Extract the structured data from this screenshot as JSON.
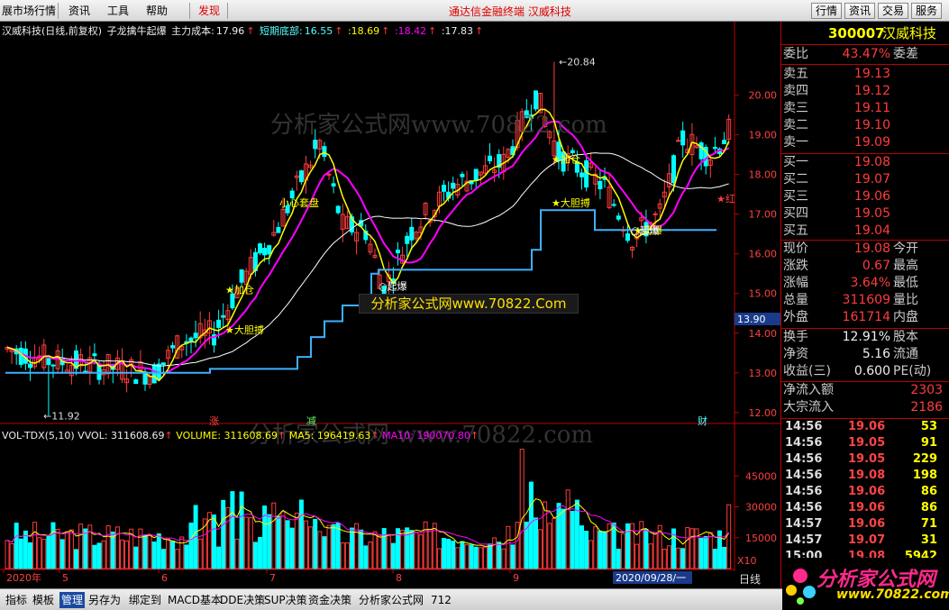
{
  "menu": {
    "items": [
      "展市场行情",
      "资讯",
      "工具",
      "帮助",
      "发现"
    ],
    "center_title": "通达信金融终端   汉威科技",
    "buttons": [
      "行情",
      "资讯",
      "交易",
      "服务"
    ]
  },
  "header": {
    "name": "汉威科技(日线,前复权)",
    "indicator": "子龙擒牛起爆",
    "cost_label": "主力成本:",
    "cost_value": "17.96",
    "bottom_label": "短期底部:",
    "bottom_value": "16.55",
    "v3": ":18.69",
    "v4": ":18.42",
    "v5": ":17.83"
  },
  "chart_data": {
    "type": "candlestick",
    "title": "汉威科技(日线,前复权)",
    "ylim": [
      11.7,
      21.4
    ],
    "y_ticks": [
      "20.00",
      "19.00",
      "18.00",
      "17.00",
      "16.00",
      "15.00",
      "14.00",
      "13.00",
      "12.00"
    ],
    "current_price_marker": "13.90",
    "high_label": "20.84",
    "low_label": "11.92",
    "annotations": [
      "小心套盘",
      "加仓",
      "大胆搏",
      "起爆",
      "起爆",
      "加仓",
      "大胆搏",
      "起爆",
      "红"
    ],
    "signals": [
      "涨",
      "减",
      "财"
    ],
    "volume": {
      "legend": [
        "VOL-TDX(5,10) VVOL: 311608.69",
        "VOLUME: 311608.69",
        "MA5: 196419.63",
        "MA10: 190070.80"
      ],
      "y_ticks": [
        "45000",
        "30000",
        "15000"
      ],
      "unit": "X10"
    },
    "date_axis": [
      "2020年",
      "5",
      "6",
      "7",
      "8",
      "9"
    ],
    "date_cursor": "2020/09/28/一"
  },
  "watermarks": {
    "top": "分析家公式网www.70822.com",
    "mid": "分析家公式网www.70822.Com",
    "vol": "分析家公式网 www.70822.com"
  },
  "quote": {
    "code": "300007",
    "name": "汉威科技",
    "weibi_label": "委比",
    "weibi": "43.47%",
    "weicha_label": "委差",
    "asks": [
      {
        "l": "卖五",
        "p": "19.13"
      },
      {
        "l": "卖四",
        "p": "19.12"
      },
      {
        "l": "卖三",
        "p": "19.11"
      },
      {
        "l": "卖二",
        "p": "19.10"
      },
      {
        "l": "卖一",
        "p": "19.09"
      }
    ],
    "bids": [
      {
        "l": "买一",
        "p": "19.08"
      },
      {
        "l": "买二",
        "p": "19.07"
      },
      {
        "l": "买三",
        "p": "19.06"
      },
      {
        "l": "买四",
        "p": "19.05"
      },
      {
        "l": "买五",
        "p": "19.04"
      }
    ],
    "stats": [
      {
        "l": "现价",
        "v": "19.08",
        "l2": "今开"
      },
      {
        "l": "涨跌",
        "v": "0.67",
        "l2": "最高"
      },
      {
        "l": "涨幅",
        "v": "3.64%",
        "l2": "最低"
      },
      {
        "l": "总量",
        "v": "311609",
        "l2": "量比"
      },
      {
        "l": "外盘",
        "v": "161714",
        "l2": "内盘"
      }
    ],
    "stats2": [
      {
        "l": "换手",
        "v": "12.91%",
        "l2": "股本"
      },
      {
        "l": "净资",
        "v": "5.16",
        "l2": "流通"
      },
      {
        "l": "收益(三)",
        "v": "0.600",
        "l2": "PE(动)"
      }
    ],
    "flows": [
      {
        "l": "净流入额",
        "v": "2303"
      },
      {
        "l": "大宗流入",
        "v": "2186"
      }
    ],
    "ticks": [
      {
        "t": "14:56",
        "p": "19.06",
        "q": "53"
      },
      {
        "t": "14:56",
        "p": "19.05",
        "q": "91"
      },
      {
        "t": "14:56",
        "p": "19.05",
        "q": "229"
      },
      {
        "t": "14:56",
        "p": "19.08",
        "q": "198"
      },
      {
        "t": "14:56",
        "p": "19.06",
        "q": "86"
      },
      {
        "t": "14:56",
        "p": "19.06",
        "q": "86"
      },
      {
        "t": "14:57",
        "p": "19.06",
        "q": "71"
      },
      {
        "t": "14:57",
        "p": "19.07",
        "q": "31"
      },
      {
        "t": "15:00",
        "p": "19.08",
        "q": "5942"
      }
    ],
    "period_label": "日线"
  },
  "bottom_tabs": [
    "指标",
    "模板",
    "管理",
    "另存为",
    "绑定到",
    "MACD基本",
    "DDE决策",
    "SUP决策",
    "资金决策",
    "分析家公式网",
    "712"
  ],
  "logo": {
    "line1": "分析家公式网",
    "line2": "www.70822.com"
  },
  "colors": {
    "up": "#ff3c3c",
    "down": "#00ffff",
    "ma_magenta": "#ff00ff",
    "ma_yellow": "#ffff00",
    "support": "#3fb0ff",
    "price_cyan": "#33ccff"
  }
}
